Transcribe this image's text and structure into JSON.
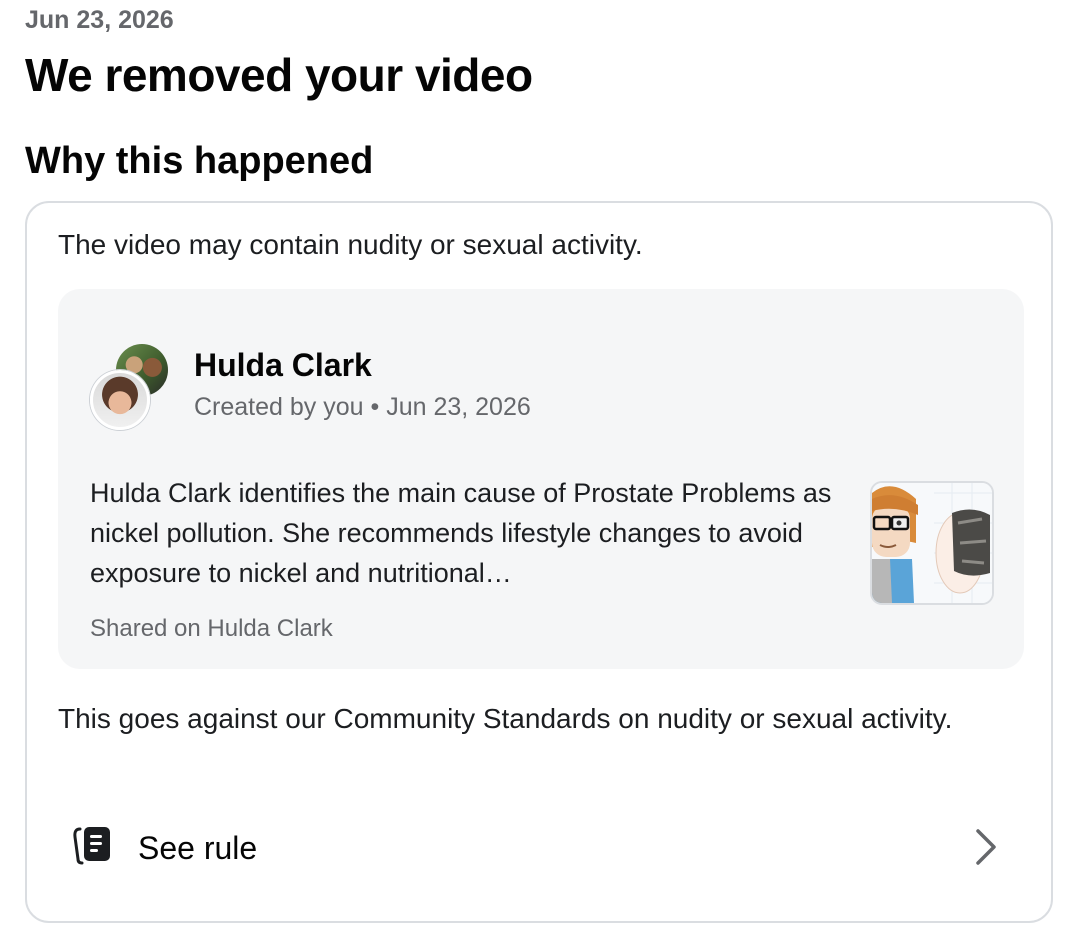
{
  "header": {
    "date": "Jun 23, 2026",
    "title": "We removed your video",
    "section_title": "Why this happened"
  },
  "card": {
    "reason": "The video may contain nudity or sexual activity.",
    "post": {
      "author": "Hulda Clark",
      "meta": "Created by you • Jun 23, 2026",
      "description": "Hulda Clark identifies the main cause of Prostate Problems as nickel pollution. She recommends lifestyle changes to avoid exposure to nickel and nutritional…",
      "shared_on": "Shared on Hulda Clark"
    },
    "standards": "This goes against our Community Standards on nudity or sexual activity.",
    "see_rule_label": "See rule"
  },
  "icons": {
    "rule": "rulebook-icon",
    "chevron": "chevron-right-icon"
  },
  "colors": {
    "text_primary": "#050505",
    "text_secondary": "#65676b",
    "card_border": "#dadde1",
    "post_background": "#f5f6f7"
  }
}
